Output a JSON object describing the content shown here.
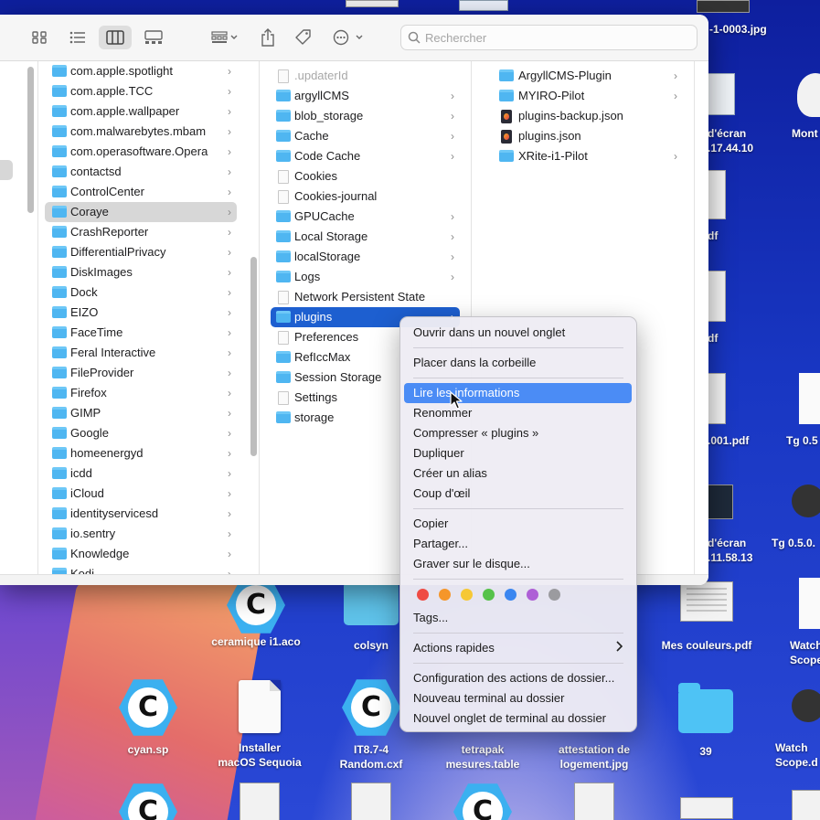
{
  "desktop": {
    "top_label": "-1-0003.jpg",
    "right_labels": [
      "d'écran",
      ".17.44.10",
      "df",
      "df",
      ".001.pdf",
      "d'écran",
      ".11.58.13"
    ],
    "far_right": [
      "Mont",
      "Tg 0.5",
      "Tg 0.5.0.",
      "Watch",
      "Scope",
      "Watch",
      "Scope.d"
    ],
    "icons": [
      {
        "label1": "ceramique i1.aco",
        "label2": ""
      },
      {
        "label1": "colsyn",
        "label2": ""
      },
      {
        "label1": "Mes couleurs.pdf",
        "label2": ""
      },
      {
        "label1": "cyan.sp",
        "label2": ""
      },
      {
        "label1": "Installer",
        "label2": "macOS Sequoia"
      },
      {
        "label1": "IT8.7-4",
        "label2": "Random.cxf"
      },
      {
        "label1": "tetrapak",
        "label2": "mesures.table"
      },
      {
        "label1": "attestation de",
        "label2": "logement.jpg"
      },
      {
        "label1": "39",
        "label2": ""
      }
    ]
  },
  "finder": {
    "search_placeholder": "Rechercher",
    "column1": [
      {
        "label": "com.apple.spotlight",
        "chevron": true
      },
      {
        "label": "com.apple.TCC",
        "chevron": true
      },
      {
        "label": "com.apple.wallpaper",
        "chevron": true
      },
      {
        "label": "com.malwarebytes.mbam",
        "chevron": true
      },
      {
        "label": "com.operasoftware.Opera",
        "chevron": true
      },
      {
        "label": "contactsd",
        "chevron": true
      },
      {
        "label": "ControlCenter",
        "chevron": true
      },
      {
        "label": "Coraye",
        "chevron": true,
        "selected": true
      },
      {
        "label": "CrashReporter",
        "chevron": true
      },
      {
        "label": "DifferentialPrivacy",
        "chevron": true
      },
      {
        "label": "DiskImages",
        "chevron": true
      },
      {
        "label": "Dock",
        "chevron": true
      },
      {
        "label": "EIZO",
        "chevron": true
      },
      {
        "label": "FaceTime",
        "chevron": true
      },
      {
        "label": "Feral Interactive",
        "chevron": true
      },
      {
        "label": "FileProvider",
        "chevron": true
      },
      {
        "label": "Firefox",
        "chevron": true
      },
      {
        "label": "GIMP",
        "chevron": true
      },
      {
        "label": "Google",
        "chevron": true
      },
      {
        "label": "homeenergyd",
        "chevron": true
      },
      {
        "label": "icdd",
        "chevron": true
      },
      {
        "label": "iCloud",
        "chevron": true
      },
      {
        "label": "identityservicesd",
        "chevron": true
      },
      {
        "label": "io.sentry",
        "chevron": true
      },
      {
        "label": "Knowledge",
        "chevron": true
      },
      {
        "label": "Kodi",
        "chevron": true
      }
    ],
    "column2": [
      {
        "label": ".updaterId",
        "kind": "file",
        "faded": true
      },
      {
        "label": "argyllCMS",
        "kind": "folder",
        "chevron": true
      },
      {
        "label": "blob_storage",
        "kind": "folder",
        "chevron": true
      },
      {
        "label": "Cache",
        "kind": "folder",
        "chevron": true
      },
      {
        "label": "Code Cache",
        "kind": "folder",
        "chevron": true
      },
      {
        "label": "Cookies",
        "kind": "file"
      },
      {
        "label": "Cookies-journal",
        "kind": "file"
      },
      {
        "label": "GPUCache",
        "kind": "folder",
        "chevron": true
      },
      {
        "label": "Local Storage",
        "kind": "folder",
        "chevron": true
      },
      {
        "label": "localStorage",
        "kind": "folder",
        "chevron": true
      },
      {
        "label": "Logs",
        "kind": "folder",
        "chevron": true
      },
      {
        "label": "Network Persistent State",
        "kind": "file"
      },
      {
        "label": "plugins",
        "kind": "folder",
        "chevron": true,
        "selected": true
      },
      {
        "label": "Preferences",
        "kind": "file"
      },
      {
        "label": "RefIccMax",
        "kind": "folder"
      },
      {
        "label": "Session Storage",
        "kind": "folder"
      },
      {
        "label": "Settings",
        "kind": "file"
      },
      {
        "label": "storage",
        "kind": "folder"
      }
    ],
    "column3": [
      {
        "label": "ArgyllCMS-Plugin",
        "kind": "folder",
        "chevron": true
      },
      {
        "label": "MYIRO-Pilot",
        "kind": "folder",
        "chevron": true
      },
      {
        "label": "plugins-backup.json",
        "kind": "json"
      },
      {
        "label": "plugins.json",
        "kind": "json"
      },
      {
        "label": "XRite-i1-Pilot",
        "kind": "folder",
        "chevron": true
      }
    ]
  },
  "context_menu": {
    "open_new_tab": "Ouvrir dans un nouvel onglet",
    "move_to_trash": "Placer dans la corbeille",
    "get_info": "Lire les informations",
    "rename": "Renommer",
    "compress": "Compresser « plugins »",
    "duplicate": "Dupliquer",
    "make_alias": "Créer un alias",
    "quick_look": "Coup d'œil",
    "copy": "Copier",
    "share": "Partager...",
    "burn": "Graver sur le disque...",
    "tags": "Tags...",
    "quick_actions": "Actions rapides",
    "folder_actions": "Configuration des actions de dossier...",
    "new_terminal": "Nouveau terminal au dossier",
    "new_terminal_tab": "Nouvel onglet de terminal au dossier",
    "tag_colors": [
      "#ef4b44",
      "#f5962a",
      "#f6c836",
      "#56c24a",
      "#3b86f0",
      "#ae5fd6",
      "#9b9b9f"
    ]
  }
}
